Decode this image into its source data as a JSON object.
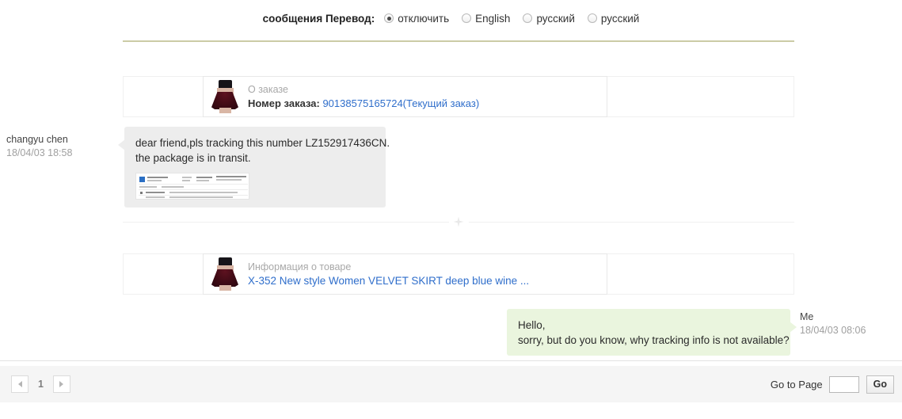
{
  "translate_bar": {
    "label": "сообщения Перевод:",
    "options": [
      {
        "text": "отключить",
        "selected": true
      },
      {
        "text": "English",
        "selected": false
      },
      {
        "text": "русский",
        "selected": false
      },
      {
        "text": "русский",
        "selected": false
      }
    ]
  },
  "conversation": {
    "order_card": {
      "caption": "О заказе",
      "label": "Номер заказа:",
      "order_number": "90138575165724(Текущий заказ)"
    },
    "incoming_message": {
      "sender": "changyu chen",
      "timestamp": "18/04/03 18:58",
      "line1": "dear friend,pls tracking this number LZ152917436CN.",
      "line2": "the package is in transit."
    },
    "product_card": {
      "caption": "Информация о товаре",
      "title": "X-352 New style Women VELVET SKIRT deep blue wine ..."
    },
    "outgoing_message": {
      "sender": "Me",
      "timestamp": "18/04/03 08:06",
      "line1": "Hello,",
      "line2": "sorry, but do you know, why tracking info is not available?"
    }
  },
  "footer": {
    "prev_label": "◀",
    "page_number": "1",
    "next_label": "▶",
    "goto_label": "Go to Page",
    "goto_value": "",
    "goto_placeholder": "",
    "go_button": "Go"
  },
  "colors": {
    "rule": "#cbcba6",
    "incoming_bubble": "#ededed",
    "outgoing_bubble": "#eaf5de",
    "link": "#2f6ecb",
    "footer_bg": "#f5f5f5"
  }
}
